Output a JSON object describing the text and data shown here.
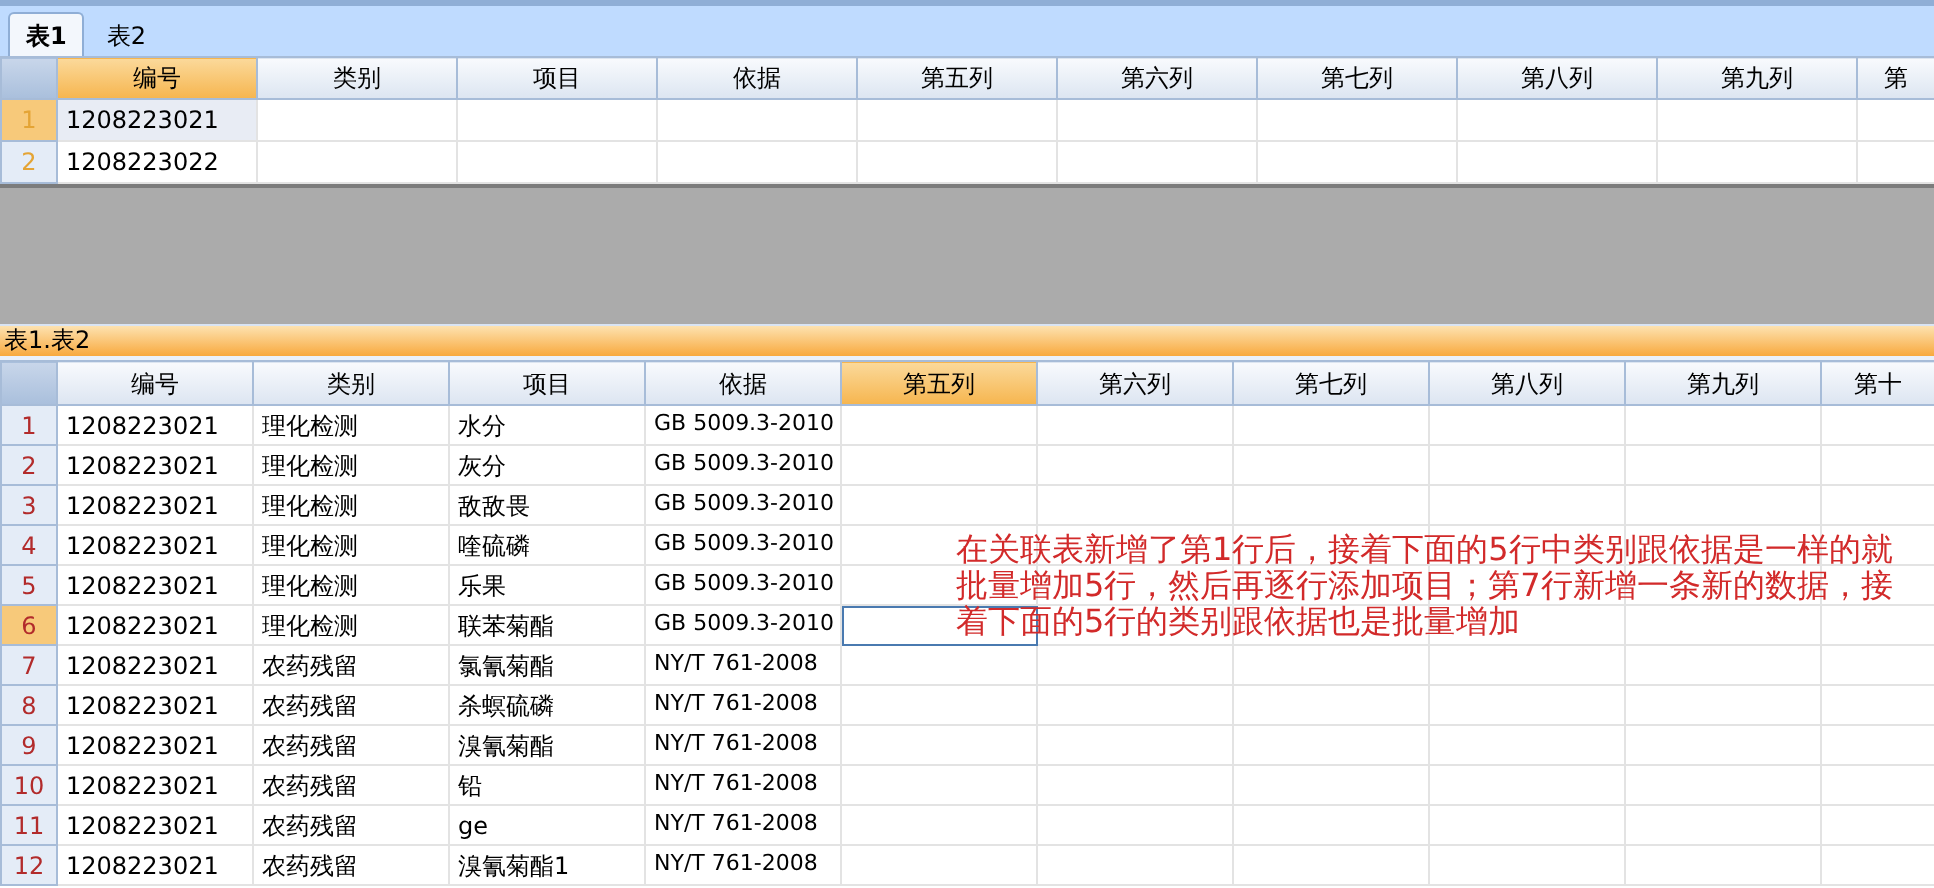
{
  "tabs": [
    {
      "label": "表1",
      "selected": true
    },
    {
      "label": "表2",
      "selected": false
    }
  ],
  "top_grid": {
    "columns": [
      {
        "label": "编号",
        "selected": true
      },
      {
        "label": "类别",
        "selected": false
      },
      {
        "label": "项目",
        "selected": false
      },
      {
        "label": "依据",
        "selected": false
      },
      {
        "label": "第五列",
        "selected": false
      },
      {
        "label": "第六列",
        "selected": false
      },
      {
        "label": "第七列",
        "selected": false
      },
      {
        "label": "第八列",
        "selected": false
      },
      {
        "label": "第九列",
        "selected": false
      },
      {
        "label": "第",
        "selected": false
      }
    ],
    "rows": [
      {
        "number": "1",
        "selected": true,
        "cells": [
          "1208223021"
        ]
      },
      {
        "number": "2",
        "selected": false,
        "cells": [
          "1208223022"
        ]
      }
    ]
  },
  "caption": "表1.表2",
  "bottom_grid": {
    "columns": [
      {
        "label": "编号",
        "selected": false
      },
      {
        "label": "类别",
        "selected": false
      },
      {
        "label": "项目",
        "selected": false
      },
      {
        "label": "依据",
        "selected": false
      },
      {
        "label": "第五列",
        "selected": true
      },
      {
        "label": "第六列",
        "selected": false
      },
      {
        "label": "第七列",
        "selected": false
      },
      {
        "label": "第八列",
        "selected": false
      },
      {
        "label": "第九列",
        "selected": false
      },
      {
        "label": "第十",
        "selected": false
      }
    ],
    "rows": [
      {
        "number": "1",
        "selected": false,
        "cells": [
          "1208223021",
          "理化检测",
          "水分",
          "GB 5009.3-2010"
        ]
      },
      {
        "number": "2",
        "selected": false,
        "cells": [
          "1208223021",
          "理化检测",
          "灰分",
          "GB 5009.3-2010"
        ]
      },
      {
        "number": "3",
        "selected": false,
        "cells": [
          "1208223021",
          "理化检测",
          "敌敌畏",
          "GB 5009.3-2010"
        ]
      },
      {
        "number": "4",
        "selected": false,
        "cells": [
          "1208223021",
          "理化检测",
          "喹硫磷",
          "GB 5009.3-2010"
        ]
      },
      {
        "number": "5",
        "selected": false,
        "cells": [
          "1208223021",
          "理化检测",
          "乐果",
          "GB 5009.3-2010"
        ]
      },
      {
        "number": "6",
        "selected": true,
        "cells": [
          "1208223021",
          "理化检测",
          "联苯菊酯",
          "GB 5009.3-2010"
        ]
      },
      {
        "number": "7",
        "selected": false,
        "cells": [
          "1208223021",
          "农药残留",
          "氯氰菊酯",
          "NY/T 761-2008"
        ]
      },
      {
        "number": "8",
        "selected": false,
        "cells": [
          "1208223021",
          "农药残留",
          "杀螟硫磷",
          "NY/T 761-2008"
        ]
      },
      {
        "number": "9",
        "selected": false,
        "cells": [
          "1208223021",
          "农药残留",
          "溴氰菊酯",
          "NY/T 761-2008"
        ]
      },
      {
        "number": "10",
        "selected": false,
        "cells": [
          "1208223021",
          "农药残留",
          "铅",
          "NY/T 761-2008"
        ]
      },
      {
        "number": "11",
        "selected": false,
        "cells": [
          "1208223021",
          "农药残留",
          "ge",
          "NY/T 761-2008"
        ]
      },
      {
        "number": "12",
        "selected": false,
        "cells": [
          "1208223021",
          "农药残留",
          "溴氰菊酯1",
          "NY/T 761-2008"
        ]
      }
    ]
  },
  "annotation": "在关联表新增了第1行后，接着下面的5行中类别跟依据是一样的就批量增加5行，然后再逐行添加项目；第7行新增一条新的数据，接着下面的5行的类别跟依据也是批量增加"
}
